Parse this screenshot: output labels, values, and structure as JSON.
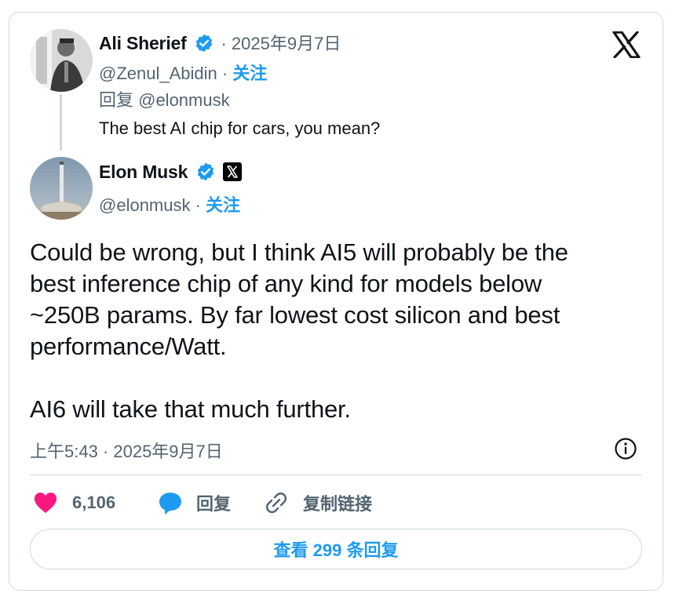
{
  "reply_tweet": {
    "author_name": "Ali Sherief",
    "date": "· 2025年9月7日",
    "handle": "@Zenul_Abidin",
    "dot": "·",
    "follow_label": "关注",
    "replying_to": "回复 @elonmusk",
    "text": "The best AI chip for cars, you mean?"
  },
  "main_tweet": {
    "author_name": "Elon Musk",
    "handle": "@elonmusk",
    "dot": "·",
    "follow_label": "关注",
    "text": "Could be wrong, but I think AI5 will probably be the\nbest inference chip of any kind for models below\n~250B params. By far lowest cost silicon and best\nperformance/Watt.\n\nAI6 will take that much further.",
    "timestamp": "上午5:43 · 2025年9月7日"
  },
  "actions": {
    "like_count": "6,106",
    "reply_label": "回复",
    "copy_link_label": "复制链接"
  },
  "view_replies_label": "查看 299 条回复",
  "colors": {
    "accent": "#1d9bf0",
    "like": "#f91880",
    "text": "#0f1419",
    "secondary": "#536471",
    "border": "#cfd9de"
  },
  "icons": [
    "x-logo-icon",
    "verified-badge-icon",
    "x-affiliate-badge-icon",
    "info-icon",
    "heart-icon",
    "reply-bubble-icon",
    "link-icon"
  ]
}
